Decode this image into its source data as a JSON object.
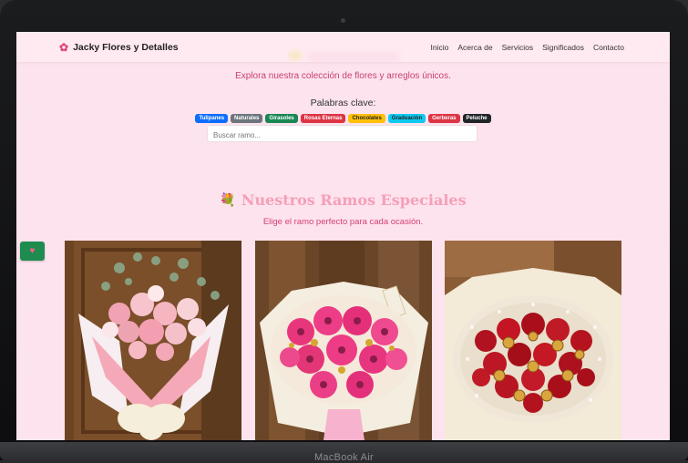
{
  "device": {
    "base_label": "MacBook Air"
  },
  "nav": {
    "brand": "Jacky Flores y Detalles",
    "brand_icon": "flower-icon",
    "links": [
      "Inicio",
      "Acerca de",
      "Servicios",
      "Significados",
      "Contacto"
    ]
  },
  "hero": {
    "subtitle": "Explora nuestra colección de flores y arreglos únicos.",
    "keywords_label": "Palabras clave:",
    "keywords": [
      {
        "label": "Tulipanes",
        "color": "#0d6efd"
      },
      {
        "label": "Naturales",
        "color": "#6c757d"
      },
      {
        "label": "Girasoles",
        "color": "#198754"
      },
      {
        "label": "Rosas Eternas",
        "color": "#dc3545"
      },
      {
        "label": "Chocolates",
        "color": "#ffc107"
      },
      {
        "label": "Graduación",
        "color": "#0dcaf0"
      },
      {
        "label": "Gerberas",
        "color": "#dc3545"
      },
      {
        "label": "Peluche",
        "color": "#212529"
      }
    ],
    "search_placeholder": "Buscar ramo..."
  },
  "section": {
    "title": "Nuestros Ramos Especiales",
    "title_icon": "bouquet-icon",
    "subtitle": "Elige el ramo perfecto para cada ocasión."
  },
  "favorite_button": {
    "icon": "heart-icon",
    "color": "#1f8c4f"
  },
  "products": [
    {
      "image": "pink-roses-eucalyptus-bouquet"
    },
    {
      "image": "pink-gerbera-bouquet"
    },
    {
      "image": "red-roses-ferrero-bouquet"
    }
  ]
}
